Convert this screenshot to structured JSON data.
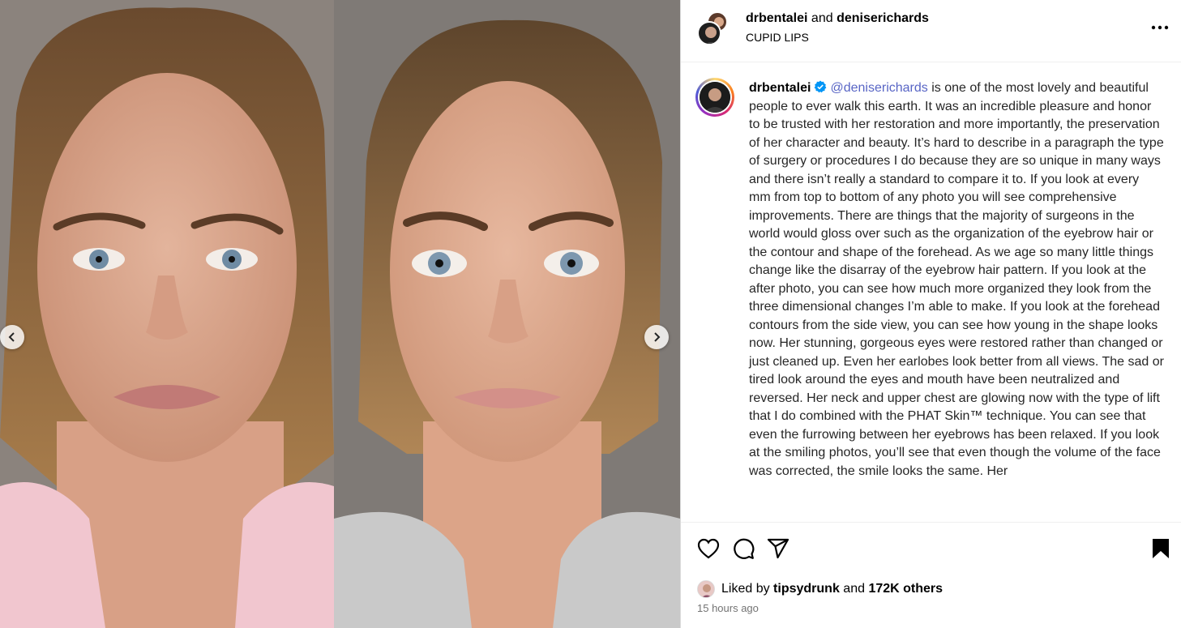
{
  "post": {
    "authors": [
      "drbentalei",
      "deniserichards"
    ],
    "and_text": "and",
    "subtitle": "CUPID LIPS"
  },
  "caption": {
    "author": "drbentalei",
    "mention": "@deniserichards",
    "text": " is one of the most lovely and beautiful people to ever walk this earth. It was an incredible pleasure and honor to be trusted with her restoration and more importantly, the preservation of her character and beauty. It’s hard to describe in a paragraph the type of surgery or procedures I do because they are so unique in many ways and there isn’t really a standard to compare it to. If you look at every mm from top to bottom of any photo you will see comprehensive improvements. There are things that the majority of surgeons in the world would gloss over such as the organization of the eyebrow hair or the contour and shape of the forehead. As we age so many little things change like the disarray of the eyebrow hair pattern. If you look at the after photo, you can see how much more organized they look from the three dimensional changes I’m able to make. If you look at the forehead contours from the side view, you can see how young in the shape looks now. Her stunning, gorgeous eyes were restored rather than changed or just cleaned up. Even her earlobes look better from all views. The sad or tired look around the eyes and mouth have been neutralized and reversed. Her neck and upper chest are glowing now with the type of lift that I do combined with the PHAT Skin™  technique. You can see that even the furrowing between her eyebrows has been relaxed. If you look at the smiling photos, you’ll see that even though the volume of the face was corrected, the smile looks the same. Her"
  },
  "likes": {
    "prefix": "Liked by",
    "user": "tipsydrunk",
    "and_text": "and",
    "others": "172K others"
  },
  "timestamp": "15 hours ago",
  "icons": {
    "nav_prev": "chevron-left-icon",
    "nav_next": "chevron-right-icon",
    "more": "more-options-icon",
    "verified": "verified-badge-icon",
    "like": "heart-icon",
    "comment": "comment-icon",
    "share": "share-icon",
    "save": "bookmark-icon"
  },
  "colors": {
    "mention": "#5865c5",
    "verified": "#0095f6",
    "muted": "#737373"
  }
}
